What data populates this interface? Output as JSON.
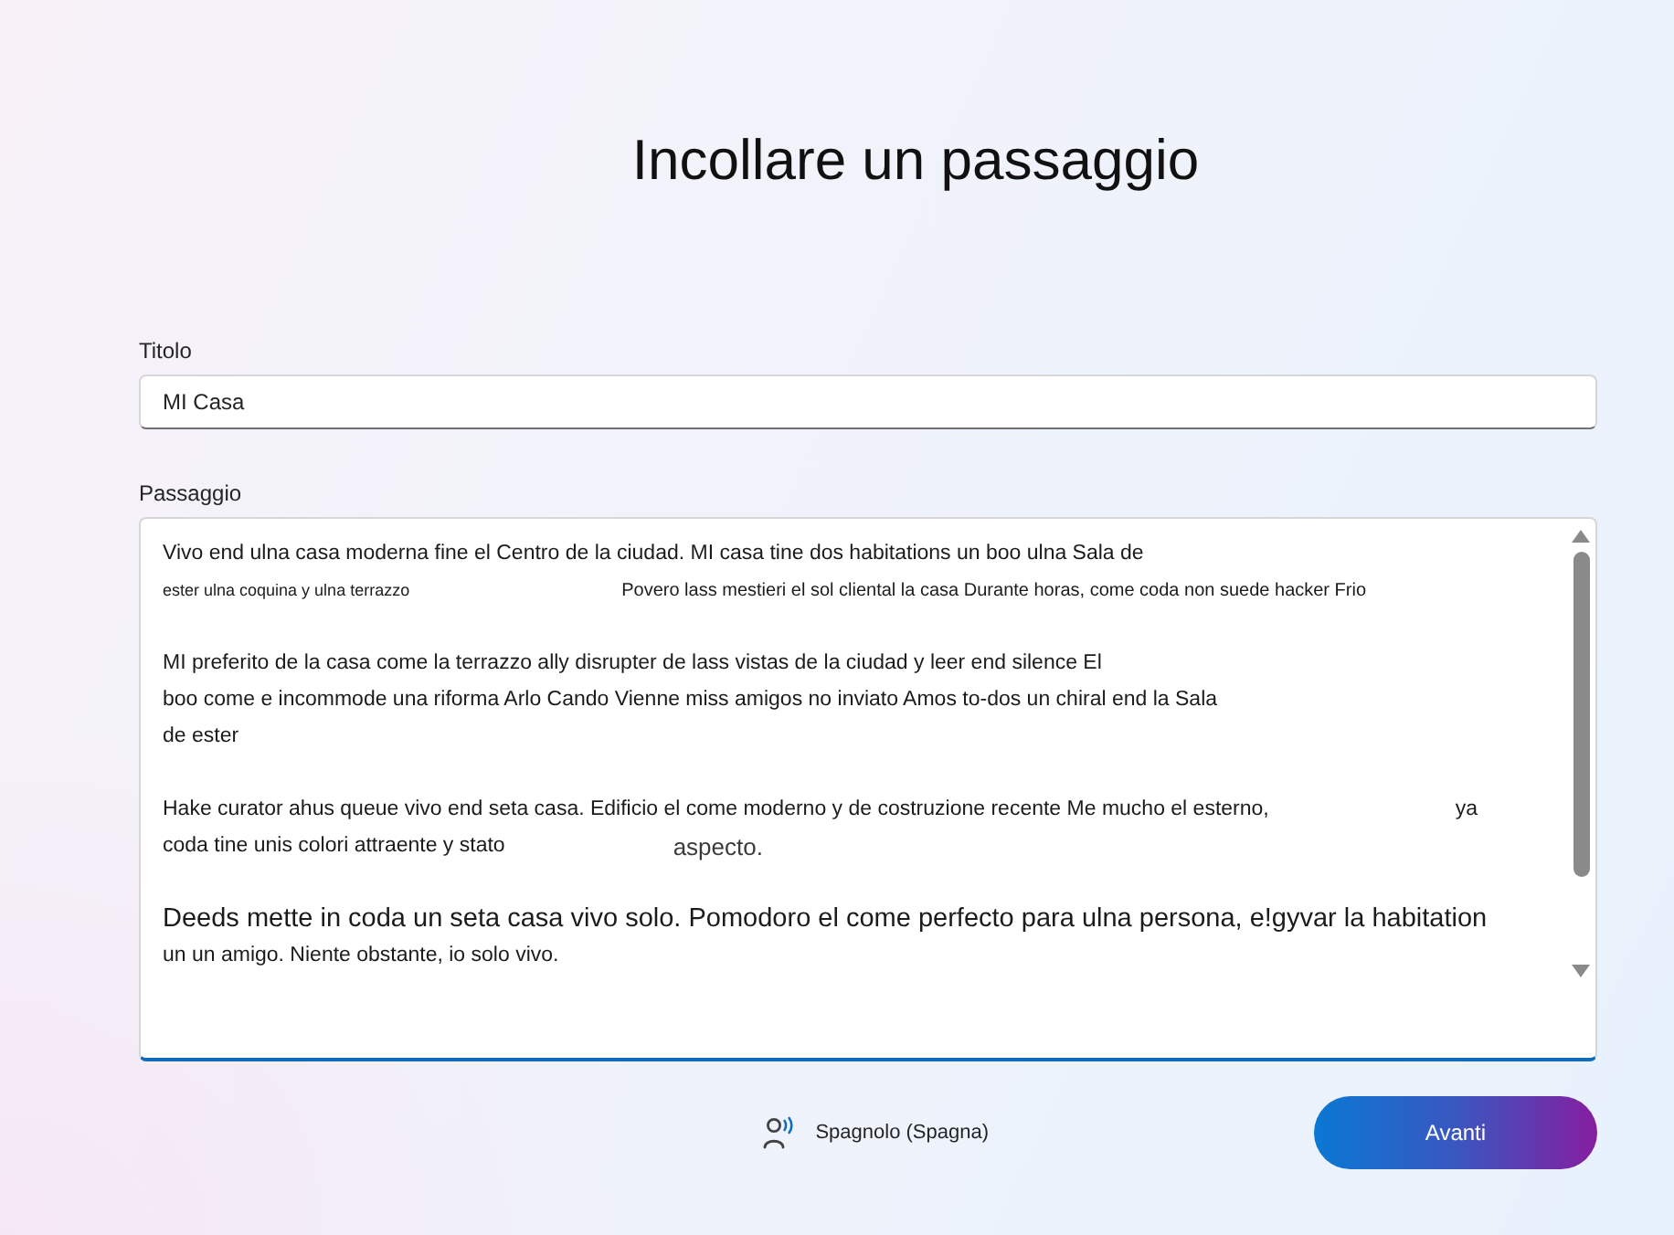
{
  "heading": "Incollare un passaggio",
  "title_field": {
    "label": "Titolo",
    "value": "MI Casa"
  },
  "passage_field": {
    "label": "Passaggio",
    "paragraphs": [
      {
        "lines": [
          {
            "segments": [
              {
                "text": "Vivo end ulna casa moderna fine el Centro de la ciudad. MI casa tine dos habitations un boo ulna Sala de",
                "kind": "regular"
              }
            ]
          },
          {
            "segments": [
              {
                "text": "ester ulna coquina y ulna terrazzo",
                "kind": "tiny"
              },
              {
                "text": "Povero lass mestieri el sol cliental la casa Durante horas, come coda non suede hacker Frio",
                "kind": "small"
              }
            ]
          }
        ]
      },
      {
        "lines": [
          {
            "segments": [
              {
                "text": "MI preferito de la casa come la terrazzo ally disrupter de lass vistas de la ciudad y leer end silence El",
                "kind": "regular"
              }
            ]
          },
          {
            "segments": [
              {
                "text": "boo come e incommode una riforma Arlo Cando Vienne miss amigos no inviato Amos to-dos un chiral end la Sala",
                "kind": "regular"
              }
            ]
          },
          {
            "segments": [
              {
                "text": "de ester",
                "kind": "regular"
              }
            ]
          }
        ]
      },
      {
        "lines": [
          {
            "segments": [
              {
                "text": "Hake curator ahus queue vivo end seta casa. Edificio el come moderno y de costruzione recente Me mucho el esterno,",
                "kind": "regular"
              },
              {
                "text": "ya",
                "kind": "regular"
              }
            ]
          },
          {
            "segments": [
              {
                "text": "coda tine unis colori attraente y stato",
                "kind": "regular"
              },
              {
                "text": "aspecto.",
                "kind": "medium"
              }
            ]
          }
        ]
      },
      {
        "lines": [
          {
            "segments": [
              {
                "text": "Deeds mette in coda un seta casa vivo solo. Pomodoro el come perfecto para ulna persona, e!gyvar la habitation",
                "kind": "large"
              }
            ]
          },
          {
            "segments": [
              {
                "text": "un un amigo. Niente obstante, io solo vivo.",
                "kind": "regular"
              }
            ]
          }
        ]
      }
    ]
  },
  "language": "Spagnolo (Spagna)",
  "buttons": [
    {
      "label": "Avanti"
    }
  ]
}
